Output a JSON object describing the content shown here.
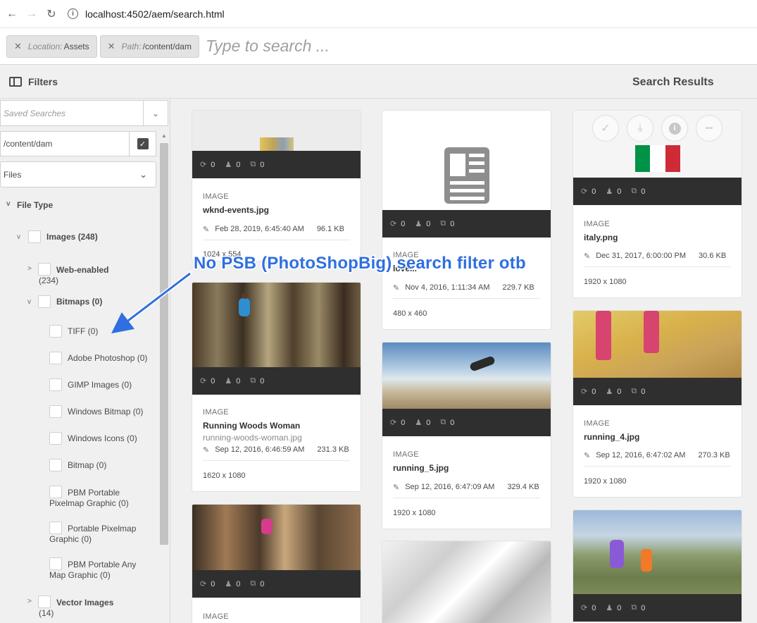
{
  "browser": {
    "back": "←",
    "forward": "→",
    "reload": "↻",
    "info": "i",
    "url": "localhost:4502/aem/search.html"
  },
  "omnisearch": {
    "tags": [
      {
        "key": "Location:",
        "value": "Assets"
      },
      {
        "key": "Path:",
        "value": "/content/dam"
      }
    ],
    "placeholder": "Type to search ..."
  },
  "header": {
    "filters_label": "Filters",
    "results_label": "Search Results"
  },
  "sidebar": {
    "saved_searches_placeholder": "Saved Searches",
    "path_value": "/content/dam",
    "type_select": "Files",
    "file_type_label": "File Type",
    "images_label": "Images (248)",
    "web_enabled_label": "Web-enabled",
    "web_enabled_count": "(234)",
    "bitmaps_label": "Bitmaps (0)",
    "bitmap_items": [
      {
        "line1": "TIFF (0)",
        "line2": ""
      },
      {
        "line1": "Adobe Photoshop (0)",
        "line2": ""
      },
      {
        "line1": "GIMP Images (0)",
        "line2": ""
      },
      {
        "line1": "Windows Bitmap (0)",
        "line2": ""
      },
      {
        "line1": "Windows Icons (0)",
        "line2": ""
      },
      {
        "line1": "Bitmap (0)",
        "line2": ""
      },
      {
        "line1": "PBM Portable",
        "line2": "Pixelmap Graphic (0)"
      },
      {
        "line1": "Portable Pixelmap",
        "line2": "Graphic (0)"
      },
      {
        "line1": "PBM Portable Any",
        "line2": "Map Graphic (0)"
      }
    ],
    "vector_label": "Vector Images",
    "vector_count": "(14)"
  },
  "annotation": "No PSB (PhotoShopBig) search filter otb",
  "cards": [
    {
      "type": "IMAGE",
      "title": "wknd-events.jpg",
      "subtitle": "",
      "date": "Feb 28, 2019, 6:45:40 AM",
      "size": "96.1 KB",
      "dimensions": "1024 x 554",
      "stats": [
        "0",
        "0",
        "0"
      ]
    },
    {
      "type": "IMAGE",
      "title": "Running Woods Woman",
      "subtitle": "running-woods-woman.jpg",
      "date": "Sep 12, 2016, 6:46:59 AM",
      "size": "231.3 KB",
      "dimensions": "1620 x 1080",
      "stats": [
        "0",
        "0",
        "0"
      ]
    },
    {
      "type": "IMAGE",
      "title": "",
      "subtitle": "",
      "date": "",
      "size": "",
      "dimensions": "",
      "stats": [
        "0",
        "0",
        "0"
      ]
    },
    {
      "type": "IMAGE",
      "title": "love...",
      "subtitle": "",
      "date": "Nov 4, 2016, 1:11:34 AM",
      "size": "229.7 KB",
      "dimensions": "480 x 460",
      "stats": [
        "0",
        "0",
        "0"
      ]
    },
    {
      "type": "IMAGE",
      "title": "running_5.jpg",
      "subtitle": "",
      "date": "Sep 12, 2016, 6:47:09 AM",
      "size": "329.4 KB",
      "dimensions": "1920 x 1080",
      "stats": [
        "0",
        "0",
        "0"
      ]
    },
    {
      "type": "IMAGE",
      "title": "italy.png",
      "subtitle": "",
      "date": "Dec 31, 2017, 6:00:00 PM",
      "size": "30.6 KB",
      "dimensions": "1920 x 1080",
      "stats": [
        "0",
        "0",
        "0"
      ]
    },
    {
      "type": "IMAGE",
      "title": "running_4.jpg",
      "subtitle": "",
      "date": "Sep 12, 2016, 6:47:02 AM",
      "size": "270.3 KB",
      "dimensions": "1920 x 1080",
      "stats": [
        "0",
        "0",
        "0"
      ]
    },
    {
      "type": "",
      "title": "",
      "subtitle": "",
      "date": "",
      "size": "",
      "dimensions": "",
      "stats": [
        "0",
        "0",
        "0"
      ]
    }
  ],
  "icons": {
    "check": "✓",
    "download": "⤓",
    "info": "i",
    "more": "•••",
    "pencil": "✎",
    "sync": "⟳",
    "person": "♟",
    "export": "⧉",
    "chev_down": "⌄",
    "tree_down": "v",
    "tree_right": ">"
  },
  "colors": {
    "meta_bar": "#2f2f2f",
    "annotation": "#2f6fe0",
    "arrow": "#2f6fe0",
    "flag_green": "#009246",
    "flag_white": "#ffffff",
    "flag_red": "#ce2b37"
  }
}
